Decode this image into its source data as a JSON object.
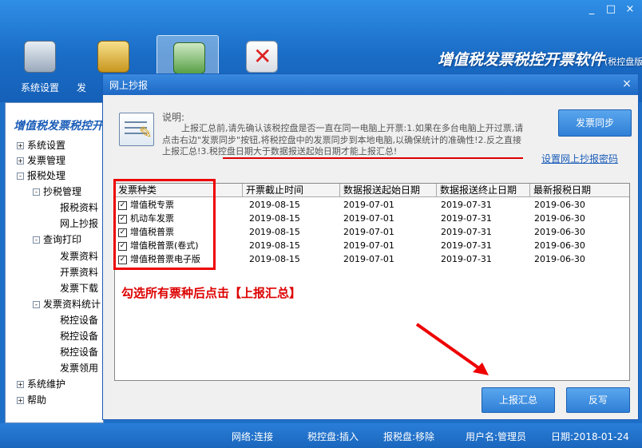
{
  "header": {
    "brand_title": "增值税发票税控开票软件",
    "brand_sub": "(税控盘版)",
    "window_controls": [
      "_",
      "□",
      "×"
    ],
    "toolbar": [
      {
        "label": "系统设置",
        "icon": "settings-panel-icon"
      },
      {
        "label": "发",
        "icon": "folder-icon"
      },
      {
        "label": "",
        "icon": "report-upload-icon"
      },
      {
        "label": "",
        "icon": "tools-icon"
      }
    ]
  },
  "sidebar": {
    "title": "增值税发票税控开",
    "tree": [
      {
        "label": "系统设置",
        "toggle": "+"
      },
      {
        "label": "发票管理",
        "toggle": "+"
      },
      {
        "label": "报税处理",
        "toggle": "-"
      },
      {
        "label": "抄税管理",
        "toggle": "-"
      },
      {
        "label": "报税资料"
      },
      {
        "label": "网上抄报"
      },
      {
        "label": "查询打印",
        "toggle": "-"
      },
      {
        "label": "发票资料"
      },
      {
        "label": "开票资料"
      },
      {
        "label": "发票下载"
      },
      {
        "label": "发票资料统计",
        "toggle": "-"
      },
      {
        "label": "税控设备"
      },
      {
        "label": "税控设备"
      },
      {
        "label": "税控设备"
      },
      {
        "label": "发票领用"
      },
      {
        "label": "系统维护",
        "toggle": "+"
      },
      {
        "label": "帮助",
        "toggle": "+"
      }
    ]
  },
  "dialog": {
    "title": "网上抄报",
    "close": "×",
    "desc_label": "说明:",
    "desc_text": "上报汇总前,请先确认该税控盘是否一直在同一电脑上开票:1.如果在多台电脑上开过票,请点击右边\"发票同步\"按钮,将税控盘中的发票同步到本地电脑,以确保统计的准确性!2.反之直接上报汇总!3.税控盘日期大于数据报送起始日期才能上报汇总!",
    "sync_button": "发票同步",
    "password_link": "设置网上抄报密码",
    "columns": [
      "发票种类",
      "开票截止时间",
      "数据报送起始日期",
      "数据报送终止日期",
      "最新报税日期"
    ],
    "rows": [
      {
        "checked": true,
        "type": "增值税专票",
        "deadline": "2019-08-15",
        "start": "2019-07-01",
        "end": "2019-07-31",
        "latest": "2019-06-30"
      },
      {
        "checked": true,
        "type": "机动车发票",
        "deadline": "2019-08-15",
        "start": "2019-07-01",
        "end": "2019-07-31",
        "latest": "2019-06-30"
      },
      {
        "checked": true,
        "type": "增值税普票",
        "deadline": "2019-08-15",
        "start": "2019-07-01",
        "end": "2019-07-31",
        "latest": "2019-06-30"
      },
      {
        "checked": true,
        "type": "增值税普票(卷式)",
        "deadline": "2019-08-15",
        "start": "2019-07-01",
        "end": "2019-07-31",
        "latest": "2019-06-30"
      },
      {
        "checked": true,
        "type": "增值税普票电子版",
        "deadline": "2019-08-15",
        "start": "2019-07-01",
        "end": "2019-07-31",
        "latest": "2019-06-30"
      }
    ],
    "instruction": "勾选所有票种后点击【上报汇总】",
    "submit_button": "上报汇总",
    "reverse_button": "反写",
    "checkbox_glyph": "✓"
  },
  "status": {
    "network": "网络:连接",
    "tax_disk": "税控盘:插入",
    "report_disk": "报税盘:移除",
    "user": "用户名:管理员",
    "date": "日期:2018-01-24"
  },
  "colors": {
    "accent": "#1e6fc8",
    "annotation": "#dd0000"
  }
}
